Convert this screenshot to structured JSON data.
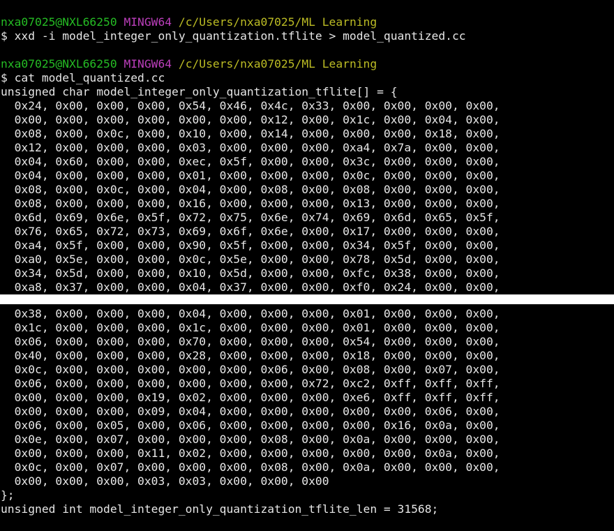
{
  "prompts": [
    {
      "user_host": "nxa07025@NXL66250",
      "shell": "MINGW64",
      "cwd": "/c/Users/nxa07025/ML Learning",
      "command": "$ xxd -i model_integer_only_quantization.tflite > model_quantized.cc"
    },
    {
      "user_host": "nxa07025@NXL66250",
      "shell": "MINGW64",
      "cwd": "/c/Users/nxa07025/ML Learning",
      "command": "$ cat model_quantized.cc"
    }
  ],
  "array_decl": "unsigned char model_integer_only_quantization_tflite[] = {",
  "hex_top": [
    "  0x24, 0x00, 0x00, 0x00, 0x54, 0x46, 0x4c, 0x33, 0x00, 0x00, 0x00, 0x00,",
    "  0x00, 0x00, 0x00, 0x00, 0x00, 0x00, 0x12, 0x00, 0x1c, 0x00, 0x04, 0x00,",
    "  0x08, 0x00, 0x0c, 0x00, 0x10, 0x00, 0x14, 0x00, 0x00, 0x00, 0x18, 0x00,",
    "  0x12, 0x00, 0x00, 0x00, 0x03, 0x00, 0x00, 0x00, 0xa4, 0x7a, 0x00, 0x00,",
    "  0x04, 0x60, 0x00, 0x00, 0xec, 0x5f, 0x00, 0x00, 0x3c, 0x00, 0x00, 0x00,",
    "  0x04, 0x00, 0x00, 0x00, 0x01, 0x00, 0x00, 0x00, 0x0c, 0x00, 0x00, 0x00,",
    "  0x08, 0x00, 0x0c, 0x00, 0x04, 0x00, 0x08, 0x00, 0x08, 0x00, 0x00, 0x00,",
    "  0x08, 0x00, 0x00, 0x00, 0x16, 0x00, 0x00, 0x00, 0x13, 0x00, 0x00, 0x00,",
    "  0x6d, 0x69, 0x6e, 0x5f, 0x72, 0x75, 0x6e, 0x74, 0x69, 0x6d, 0x65, 0x5f,",
    "  0x76, 0x65, 0x72, 0x73, 0x69, 0x6f, 0x6e, 0x00, 0x17, 0x00, 0x00, 0x00,",
    "  0xa4, 0x5f, 0x00, 0x00, 0x90, 0x5f, 0x00, 0x00, 0x34, 0x5f, 0x00, 0x00,",
    "  0xa0, 0x5e, 0x00, 0x00, 0x0c, 0x5e, 0x00, 0x00, 0x78, 0x5d, 0x00, 0x00,",
    "  0x34, 0x5d, 0x00, 0x00, 0x10, 0x5d, 0x00, 0x00, 0xfc, 0x38, 0x00, 0x00,",
    "  0xa8, 0x37, 0x00, 0x00, 0x04, 0x37, 0x00, 0x00, 0xf0, 0x24, 0x00, 0x00,"
  ],
  "hex_bottom": [
    "  0x38, 0x00, 0x00, 0x00, 0x04, 0x00, 0x00, 0x00, 0x01, 0x00, 0x00, 0x00,",
    "  0x1c, 0x00, 0x00, 0x00, 0x1c, 0x00, 0x00, 0x00, 0x01, 0x00, 0x00, 0x00,",
    "  0x06, 0x00, 0x00, 0x00, 0x70, 0x00, 0x00, 0x00, 0x54, 0x00, 0x00, 0x00,",
    "  0x40, 0x00, 0x00, 0x00, 0x28, 0x00, 0x00, 0x00, 0x18, 0x00, 0x00, 0x00,",
    "  0x0c, 0x00, 0x00, 0x00, 0x00, 0x00, 0x06, 0x00, 0x08, 0x00, 0x07, 0x00,",
    "  0x06, 0x00, 0x00, 0x00, 0x00, 0x00, 0x00, 0x72, 0xc2, 0xff, 0xff, 0xff,",
    "  0x00, 0x00, 0x00, 0x19, 0x02, 0x00, 0x00, 0x00, 0xe6, 0xff, 0xff, 0xff,",
    "  0x00, 0x00, 0x00, 0x09, 0x04, 0x00, 0x00, 0x00, 0x00, 0x00, 0x06, 0x00,",
    "  0x06, 0x00, 0x05, 0x00, 0x06, 0x00, 0x00, 0x00, 0x00, 0x16, 0x0a, 0x00,",
    "  0x0e, 0x00, 0x07, 0x00, 0x00, 0x00, 0x08, 0x00, 0x0a, 0x00, 0x00, 0x00,",
    "  0x00, 0x00, 0x00, 0x11, 0x02, 0x00, 0x00, 0x00, 0x00, 0x00, 0x0a, 0x00,",
    "  0x0c, 0x00, 0x07, 0x00, 0x00, 0x00, 0x08, 0x00, 0x0a, 0x00, 0x00, 0x00,",
    "  0x00, 0x00, 0x00, 0x03, 0x03, 0x00, 0x00, 0x00"
  ],
  "array_close": "};",
  "len_decl": "unsigned int model_integer_only_quantization_tflite_len = 31568;",
  "colors": {
    "background": "#000000",
    "text": "#e6e6e6",
    "user_host": "#25bc24",
    "shell": "#bc3fbc",
    "cwd": "#bcbc24",
    "separator": "#ffffff"
  }
}
